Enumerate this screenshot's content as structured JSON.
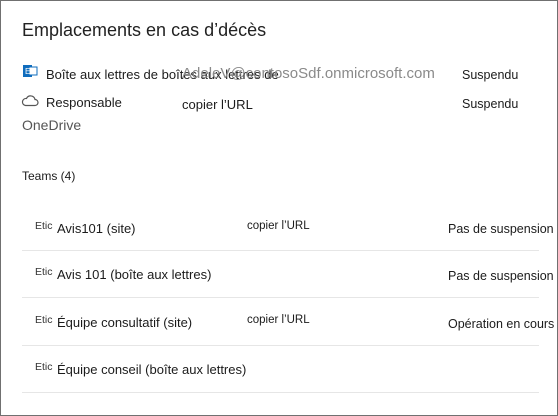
{
  "title": "Emplacements en cas d’décès",
  "locations": {
    "mailbox": {
      "icon": "exchange-icon",
      "label": "Boîte aux lettres de boîtes aux lettres de",
      "email": "AdeleV@contosoSdf.onmicrosoft.com",
      "status": "Suspendu"
    },
    "onedrive": {
      "icon": "cloud-icon",
      "label": "Responsable",
      "label_cont": "OneDrive",
      "url_label": "copier l’URL",
      "status": "Suspendu"
    }
  },
  "teams": {
    "header": "Teams (4)",
    "rows": [
      {
        "prefix": "Etic",
        "name": "Avis101 (site)",
        "url_label": "copier l’URL",
        "status": "Pas de suspension"
      },
      {
        "prefix": "Etic",
        "name": "Avis 101 (boîte aux lettres)",
        "url_label": "",
        "status": "Pas de suspension"
      },
      {
        "prefix": "Etic",
        "name": "Équipe consultatif (site)",
        "url_label": "copier l’URL",
        "status": "Opération en cours"
      },
      {
        "prefix": "Etic",
        "name": "Équipe conseil (boîte aux lettres)",
        "url_label": "",
        "status": ""
      }
    ]
  },
  "colors": {
    "exchange_blue": "#0f6cbd",
    "border": "#707070",
    "separator": "#e6e6e6",
    "ghost_text": "#8a8a8a"
  }
}
